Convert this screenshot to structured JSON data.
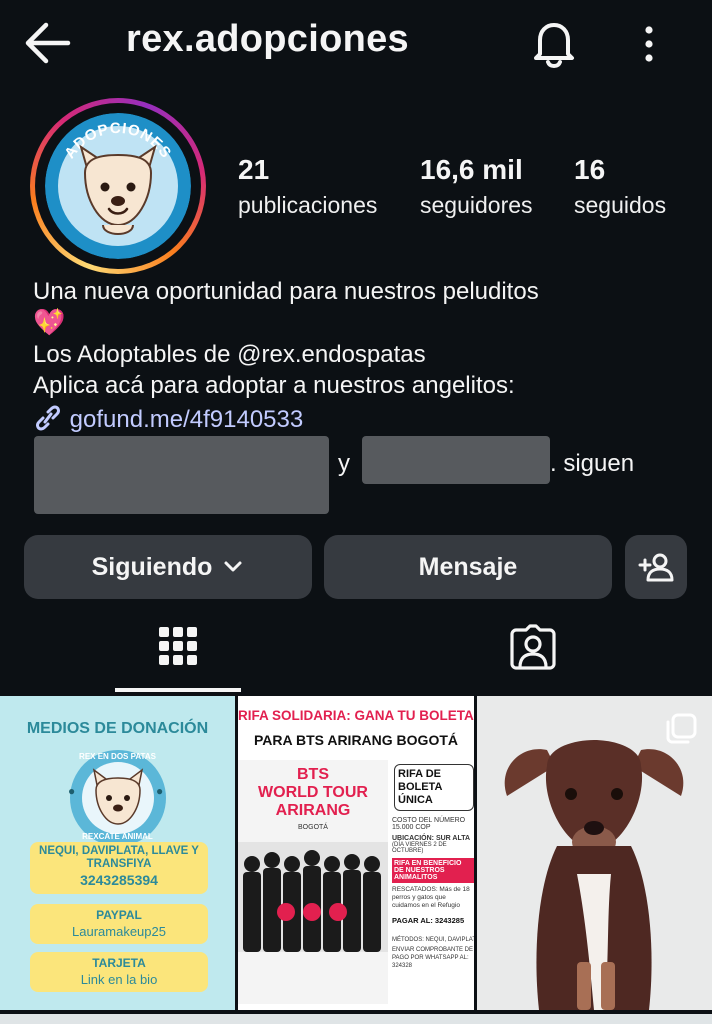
{
  "header": {
    "username": "rex.adopciones"
  },
  "avatar": {
    "badge_text": "ADOPCIONES"
  },
  "stats": [
    {
      "value": "21",
      "label": "publicaciones"
    },
    {
      "value": "16,6 mil",
      "label": "seguidores"
    },
    {
      "value": "16",
      "label": "seguidos"
    }
  ],
  "bio": {
    "line1": "Una nueva oportunidad para nuestros peluditos",
    "emoji": "💖",
    "line2": "Los Adoptables de @rex.endospatas",
    "line3": "Aplica acá para adoptar a nuestros  angelitos:",
    "link": "gofund.me/4f9140533",
    "followed_by_conj": "y",
    "followed_by_suffix": ". siguen"
  },
  "buttons": {
    "following": "Siguiendo",
    "message": "Mensaje"
  },
  "posts": {
    "post1": {
      "title": "MEDIOS DE DONACIÓN",
      "ring_top": "REX EN DOS PATAS",
      "ring_bottom": "REXCATE ANIMAL",
      "nequi_title": "NEQUI, DAVIPLATA, LLAVE Y TRANSFIYA",
      "nequi_number": "3243285394",
      "paypal_title": "PAYPAL",
      "paypal_value": "Lauramakeup25",
      "card_title": "TARJETA",
      "card_value": "Link en la bio"
    },
    "post2": {
      "banner1": "RIFA SOLIDARIA: GANA TU BOLETA",
      "banner2": "PARA BTS ARIRANG BOGOTÁ",
      "tour1": "BTS",
      "tour2": "WORLD TOUR",
      "tour3": "ARIRANG",
      "city": "BOGOTÁ",
      "raffle_title": "RIFA DE BOLETA ÚNICA",
      "cost_label": "COSTO DEL NÚMERO",
      "cost_value": "15.000 COP",
      "location": "UBICACIÓN: SUR ALTA",
      "date": "(DÍA VIERNES 2 DE OCTUBRE)",
      "benefit": "RIFA EN BENEFICIO DE NUESTROS ANIMALITOS",
      "rescued": "RESCATADOS: Más de 18 perros y gatos que cuidamos en el Refugio",
      "pay": "PAGAR AL: 3243285",
      "methods": "MÉTODOS: NEQUI, DAVIPLATA, LL",
      "send": "ENVIAR COMPROBANTE DE PAGO POR WHATSAPP AL: 324328"
    }
  }
}
